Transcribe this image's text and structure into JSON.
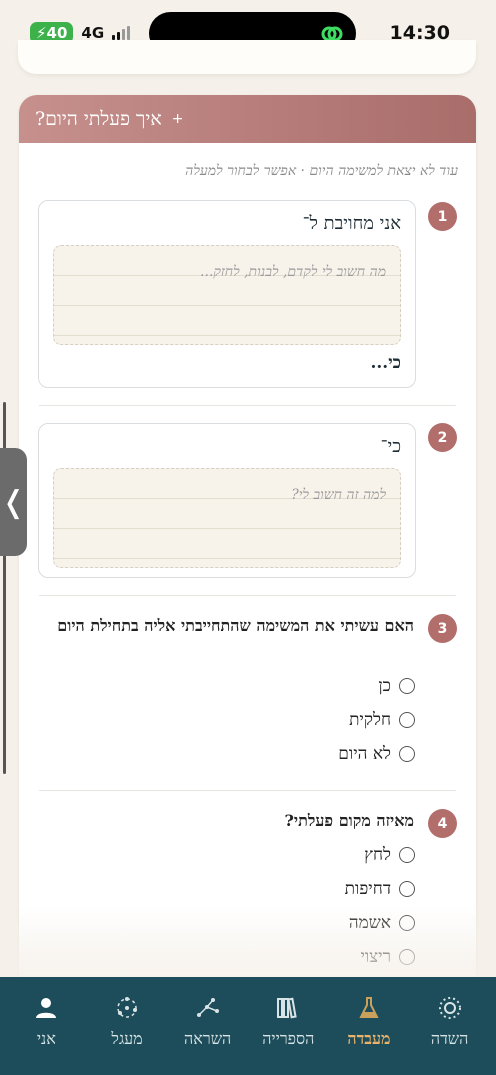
{
  "status_bar": {
    "battery": "40",
    "network": "4G",
    "time": "14:30"
  },
  "section": {
    "title": "איך פעלתי היום?",
    "expand_icon": "plus-icon",
    "hint": "עוד לא יצאת למשימה היום · אפשר לבחור למעלה"
  },
  "q1": {
    "number": "1",
    "label": "אני מחויבת ל־",
    "placeholder": "מה חשוב לי לקדם, לבנות, לחזק...",
    "suffix": "כי..."
  },
  "q2": {
    "number": "2",
    "label": "כי־",
    "placeholder": "למה זה חשוב לי?"
  },
  "q3": {
    "number": "3",
    "question": "האם עשיתי את המשימה שהתחייבתי אליה בתחילת היום",
    "options": [
      "כן",
      "חלקית",
      "לא היום"
    ]
  },
  "q4": {
    "number": "4",
    "question": "מאיזה מקום פעלתי?",
    "options": [
      "לחץ",
      "דחיפות",
      "אשמה",
      "ריצוי"
    ]
  },
  "side_handle": {
    "glyph": "❬"
  },
  "nav": {
    "active": "מעבדה",
    "items": [
      {
        "label": "השדה",
        "icon": "field-icon"
      },
      {
        "label": "מעבדה",
        "icon": "flask-icon"
      },
      {
        "label": "הספרייה",
        "icon": "library-icon"
      },
      {
        "label": "השראה",
        "icon": "constellation-icon"
      },
      {
        "label": "מעגל",
        "icon": "circle-icon"
      },
      {
        "label": "אני",
        "icon": "person-icon"
      }
    ]
  },
  "colors": {
    "header": "#b07774",
    "nav_bg": "#1d4d5a",
    "nav_active": "#e9b36b",
    "badge": "#b26e6b"
  }
}
